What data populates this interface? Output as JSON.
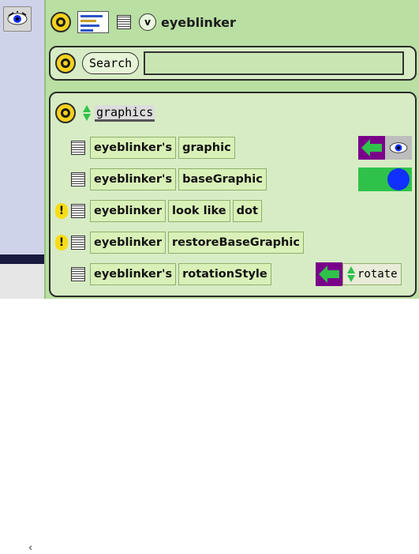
{
  "header": {
    "title": "eyeblinker",
    "viewer_menu_letter": "v"
  },
  "search": {
    "button_label": "Search",
    "value": ""
  },
  "category": {
    "name": "graphics"
  },
  "rows": [
    {
      "subject": "eyeblinker's",
      "slot": "graphic"
    },
    {
      "subject": "eyeblinker's",
      "slot": "baseGraphic"
    },
    {
      "subject": "eyeblinker",
      "command": "look like",
      "arg": "dot"
    },
    {
      "subject": "eyeblinker",
      "command": "restoreBaseGraphic"
    },
    {
      "subject": "eyeblinker's",
      "slot": "rotationStyle",
      "value": "rotate"
    }
  ],
  "sidebar": {
    "scroll_arrow": "‹"
  },
  "colors": {
    "viewer_bg": "#b9dfa3",
    "panel_bg": "#d7ecc5",
    "tile_bg": "#d9f0b8",
    "menu_button": "#f6d21d",
    "arrow_bg": "#7a008a",
    "arrow_green": "#2fc24a",
    "basegraphic_dot": "#1030ff"
  },
  "icons": {
    "sidebar_tile": "eye-icon",
    "menu": "menu-circle-icon",
    "assign": "left-arrow-icon",
    "warning": "exclamation-icon",
    "updown": "up-down-arrows-icon"
  }
}
